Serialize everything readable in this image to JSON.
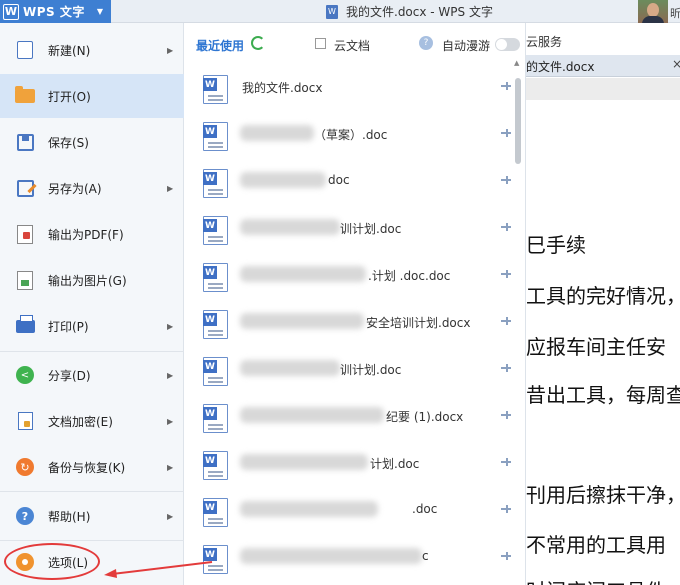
{
  "titlebar": {
    "app_button": "WPS 文字",
    "app_logo": "W",
    "document_title": "我的文件.docx - WPS 文字",
    "doc_icon": "W",
    "user_char": "昕"
  },
  "background_doc": {
    "cloud_service": "云服务",
    "tab_label": "的文件.docx",
    "tab_close": "×",
    "lines": [
      "巳手续",
      "工具的完好情况，",
      "应报车间主任安",
      "昔出工具，每周查",
      "刊用后擦抹干净，",
      "不常用的工具用",
      "时间序间工具件"
    ]
  },
  "menu": {
    "items": [
      {
        "label": "新建(N)",
        "icon": "new-doc-icon",
        "arrow": "▶"
      },
      {
        "label": "打开(O)",
        "icon": "folder-open-icon"
      },
      {
        "label": "保存(S)",
        "icon": "save-icon"
      },
      {
        "label": "另存为(A)",
        "icon": "save-as-icon",
        "arrow": "▶"
      },
      {
        "label": "输出为PDF(F)",
        "icon": "export-pdf-icon"
      },
      {
        "label": "输出为图片(G)",
        "icon": "export-image-icon"
      },
      {
        "label": "打印(P)",
        "icon": "print-icon",
        "arrow": "▶"
      },
      {
        "label": "分享(D)",
        "icon": "share-icon",
        "arrow": "▶"
      },
      {
        "label": "文档加密(E)",
        "icon": "encrypt-icon",
        "arrow": "▶"
      },
      {
        "label": "备份与恢复(K)",
        "icon": "backup-icon",
        "arrow": "▶"
      },
      {
        "label": "帮助(H)",
        "icon": "help-icon",
        "arrow": "▶"
      },
      {
        "label": "选项(L)",
        "icon": "gear-icon"
      }
    ],
    "share_glyph": "<",
    "backup_glyph": "↻",
    "help_glyph": "?"
  },
  "recent": {
    "title": "最近使用",
    "cloud_doc_label": "云文档",
    "auto_roam_label": "自动漫游",
    "help_glyph": "?",
    "files": [
      "我的文件.docx",
      "（草案）.doc",
      "doc",
      "训计划.doc",
      ".计划 .doc.doc",
      "安全培训计划.docx",
      "训计划.doc",
      "纪要 (1).docx",
      "计划.doc",
      ".doc",
      "c"
    ]
  },
  "scrollbar": {
    "up_glyph": "▲"
  }
}
